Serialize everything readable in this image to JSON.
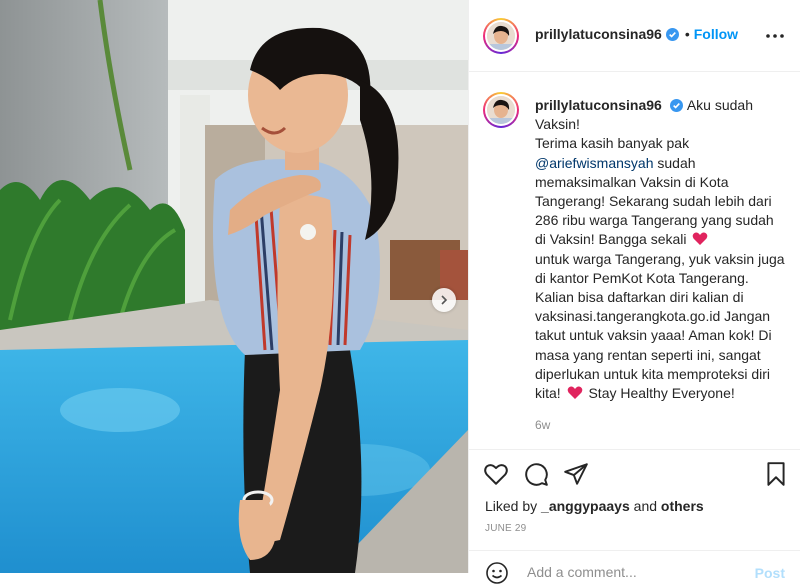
{
  "post": {
    "username": "prillylatuconsina96",
    "verified": true,
    "dot": "•",
    "follow_label": "Follow",
    "more_icon": "more-horizontal-icon"
  },
  "caption": {
    "username": "prillylatuconsina96",
    "line1": "Aku sudah Vaksin!",
    "line2": "Terima kasih banyak pak",
    "mention": "@ariefwismansyah",
    "line3": "sudah memaksimalkan Vaksin di Kota Tangerang! Sekarang sudah lebih dari 286 ribu warga Tangerang yang sudah di Vaksin! Bangga sekali",
    "line4": "untuk warga Tangerang, yuk vaksin juga di kantor PemKot Kota Tangerang. Kalian bisa daftarkan diri kalian di vaksinasi.tangerangkota.go.id Jangan takut untuk vaksin yaaa! Aman kok! Di masa yang rentan seperti ini, sangat diperlukan untuk kita memproteksi diri kita!",
    "line5": "Stay Healthy Everyone!",
    "heart_color": "#e0245e",
    "age": "6w"
  },
  "actions": {
    "icons": [
      "heart-icon",
      "comment-icon",
      "share-icon",
      "bookmark-icon"
    ],
    "liked_prefix": "Liked by",
    "liked_user": "_anggypaays",
    "liked_and": "and",
    "liked_others": "others",
    "date": "JUNE 29"
  },
  "add_comment": {
    "placeholder": "Add a comment...",
    "post_label": "Post"
  },
  "colors": {
    "accent": "#0095f6",
    "text": "#262626",
    "muted": "#8e8e8e",
    "border": "#efefef"
  }
}
